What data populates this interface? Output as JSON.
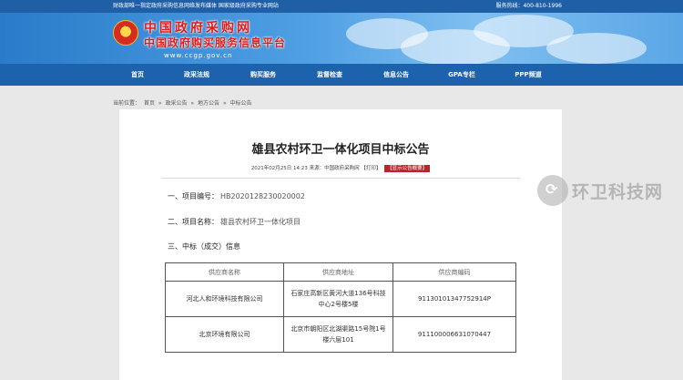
{
  "topbar": {
    "left_text": "财政部唯一指定政府采购信息网络发布媒体 国家级政府采购专业网站",
    "right_text": "服务热线：400-810-1996"
  },
  "header": {
    "title": "中国政府采购网",
    "subtitle": "中国政府购买服务信息平台",
    "url": "www.ccgp.gov.cn"
  },
  "nav": {
    "items": [
      "首页",
      "政采法规",
      "购买服务",
      "监督检查",
      "信息公告",
      "GPA专栏",
      "PPP频道"
    ]
  },
  "breadcrumb": {
    "prefix": "当前位置：",
    "items": [
      "首页",
      "»",
      "政采公告",
      "»",
      "地方公告",
      "»",
      "中标公告"
    ]
  },
  "notice": {
    "title": "雄县农村环卫一体化项目中标公告",
    "meta": "2021年02月25日 14:23 来源：中国政府采购网 【打印】",
    "badge": "【显示公告概要】",
    "sections": [
      {
        "label": "一、项目编号：",
        "value": "HB2020128230020002"
      },
      {
        "label": "二、项目名称：",
        "value": "雄县农村环卫一体化项目"
      },
      {
        "label": "三、中标（成交）信息",
        "value": ""
      }
    ],
    "table": {
      "headers": [
        "供应商名称",
        "供应商地址",
        "供应商编码"
      ],
      "rows": [
        [
          "河北人和环境科技有限公司",
          "石家庄高新区黄河大道136号科技中心2号楼5楼",
          "91130101347752914P"
        ],
        [
          "北京环境有限公司",
          "北京市朝阳区北湖渠路15号院1号楼六层101",
          "911100006631070447"
        ]
      ]
    }
  },
  "watermark": {
    "text": "环卫科技网"
  }
}
